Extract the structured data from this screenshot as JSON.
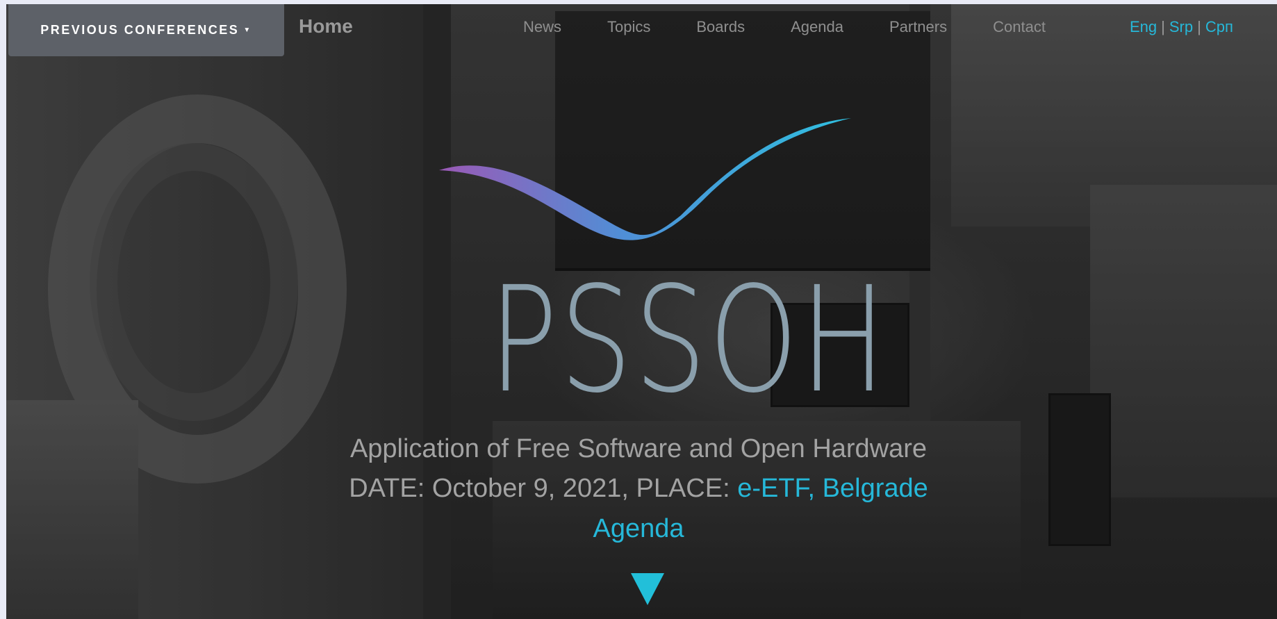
{
  "navbar": {
    "previous_conferences": "PREVIOUS CONFERENCES",
    "home": "Home",
    "links": [
      "News",
      "Topics",
      "Boards",
      "Agenda",
      "Partners",
      "Contact"
    ],
    "languages": [
      "Eng",
      "Srp",
      "Срп"
    ],
    "language_separator": "|"
  },
  "hero": {
    "logo_text": "PSSOH",
    "tagline": "Application of Free Software and Open Hardware",
    "date_prefix": "DATE: October 9, 2021, PLACE: ",
    "place": "e-ETF, Belgrade",
    "agenda_link": "Agenda",
    "scroll_icon": "triangle-down-icon"
  },
  "colors": {
    "accent": "#26b8d9",
    "nav_text": "#8f8f8f",
    "dropdown_bg": "#5d6168",
    "logo_text": "#8a9fac",
    "swoosh_start": "#9b59b6",
    "swoosh_end": "#2fc0e0"
  }
}
